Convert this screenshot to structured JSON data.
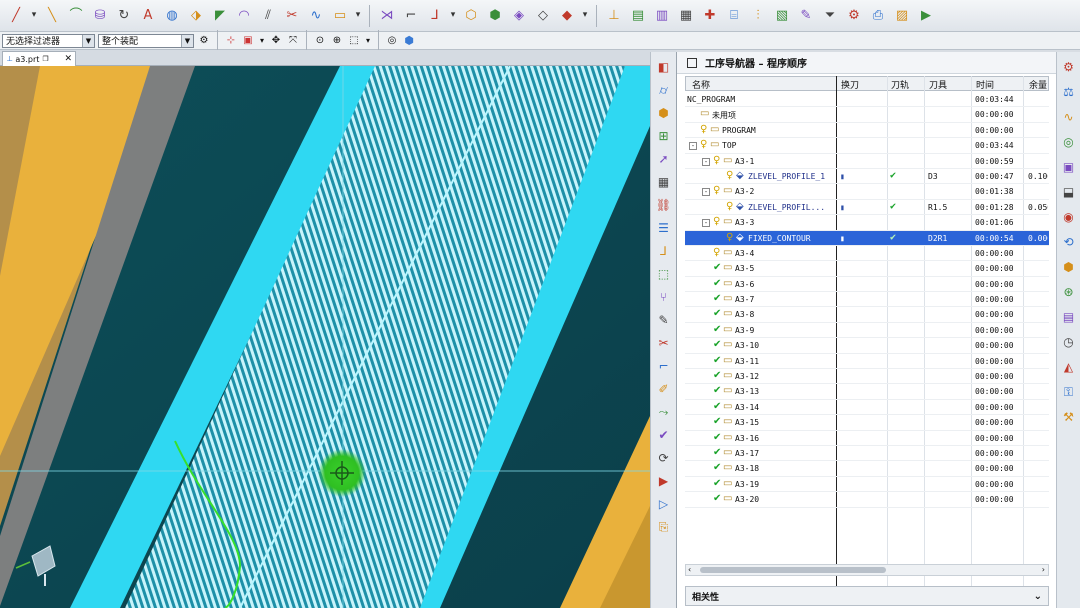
{
  "toolbar": {
    "icons": [
      "line-icon",
      "dropdown-icon",
      "line2-icon",
      "arc-icon",
      "cylinder-icon",
      "rotate-icon",
      "text-icon",
      "hole-icon",
      "extrude-icon",
      "chamfer-icon",
      "blend-icon",
      "offset-icon",
      "trim-icon",
      "curve-icon",
      "rectangle-icon",
      "dropdown-icon",
      "shear-icon",
      "fillet-icon",
      "bend-icon",
      "dropdown-icon",
      "tool-icon",
      "tool2-icon",
      "tool3-icon",
      "tool4-icon",
      "tool5-icon",
      "dropdown-icon",
      "axes-icon",
      "program-icon",
      "geometry-icon",
      "method-icon",
      "create-icon",
      "machine-icon",
      "align-icon",
      "report-icon",
      "edit-icon",
      "filter-icon",
      "gear-icon",
      "postprocess-icon",
      "shop-doc-icon",
      "verify-icon"
    ]
  },
  "toolbar2": {
    "filter_value": "无选择过滤器",
    "assembly_value": "整个装配"
  },
  "file_tab": {
    "label": "a3.prt"
  },
  "navigator": {
    "title": "工序导航器 – 程序顺序",
    "columns": [
      "名称",
      "换刀",
      "刀轨",
      "刀具",
      "时间",
      "余量"
    ],
    "rows": [
      {
        "name": "NC_PROGRAM",
        "indent": 0,
        "icon": "none",
        "fold": "",
        "tool_change": "",
        "path": "",
        "tool": "",
        "time": "00:03:44",
        "stock": ""
      },
      {
        "name": "未用项",
        "indent": 1,
        "icon": "folder",
        "fold": "",
        "tool_change": "",
        "path": "",
        "tool": "",
        "time": "00:00:00",
        "stock": ""
      },
      {
        "name": "PROGRAM",
        "indent": 1,
        "icon": "key",
        "fold": "",
        "tool_change": "",
        "path": "",
        "tool": "",
        "time": "00:00:00",
        "stock": ""
      },
      {
        "name": "TOP",
        "indent": 1,
        "icon": "key",
        "fold": "-",
        "tool_change": "",
        "path": "",
        "tool": "",
        "time": "00:03:44",
        "stock": ""
      },
      {
        "name": "A3-1",
        "indent": 2,
        "icon": "key",
        "fold": "-",
        "tool_change": "",
        "path": "",
        "tool": "",
        "time": "00:00:59",
        "stock": ""
      },
      {
        "name": "ZLEVEL_PROFILE_1",
        "indent": 3,
        "icon": "op",
        "fold": "",
        "tool_change": "▮",
        "path": "✔",
        "tool": "D3",
        "time": "00:00:47",
        "stock": "0.100"
      },
      {
        "name": "A3-2",
        "indent": 2,
        "icon": "key",
        "fold": "-",
        "tool_change": "",
        "path": "",
        "tool": "",
        "time": "00:01:38",
        "stock": ""
      },
      {
        "name": "ZLEVEL_PROFIL...",
        "indent": 3,
        "icon": "op",
        "fold": "",
        "tool_change": "▮",
        "path": "✔",
        "tool": "R1.5",
        "time": "00:01:28",
        "stock": "0.050"
      },
      {
        "name": "A3-3",
        "indent": 2,
        "icon": "key",
        "fold": "-",
        "tool_change": "",
        "path": "",
        "tool": "",
        "time": "00:01:06",
        "stock": ""
      },
      {
        "name": "FIXED_CONTOUR",
        "indent": 3,
        "icon": "op",
        "fold": "",
        "tool_change": "▮",
        "path": "✔",
        "tool": "D2R1",
        "time": "00:00:54",
        "stock": "0.000",
        "selected": true
      },
      {
        "name": "A3-4",
        "indent": 2,
        "icon": "key",
        "fold": "",
        "tool_change": "",
        "path": "",
        "tool": "",
        "time": "00:00:00",
        "stock": ""
      },
      {
        "name": "A3-5",
        "indent": 2,
        "icon": "check",
        "fold": "",
        "tool_change": "",
        "path": "",
        "tool": "",
        "time": "00:00:00",
        "stock": ""
      },
      {
        "name": "A3-6",
        "indent": 2,
        "icon": "check",
        "fold": "",
        "tool_change": "",
        "path": "",
        "tool": "",
        "time": "00:00:00",
        "stock": ""
      },
      {
        "name": "A3-7",
        "indent": 2,
        "icon": "check",
        "fold": "",
        "tool_change": "",
        "path": "",
        "tool": "",
        "time": "00:00:00",
        "stock": ""
      },
      {
        "name": "A3-8",
        "indent": 2,
        "icon": "check",
        "fold": "",
        "tool_change": "",
        "path": "",
        "tool": "",
        "time": "00:00:00",
        "stock": ""
      },
      {
        "name": "A3-9",
        "indent": 2,
        "icon": "check",
        "fold": "",
        "tool_change": "",
        "path": "",
        "tool": "",
        "time": "00:00:00",
        "stock": ""
      },
      {
        "name": "A3-10",
        "indent": 2,
        "icon": "check",
        "fold": "",
        "tool_change": "",
        "path": "",
        "tool": "",
        "time": "00:00:00",
        "stock": ""
      },
      {
        "name": "A3-11",
        "indent": 2,
        "icon": "check",
        "fold": "",
        "tool_change": "",
        "path": "",
        "tool": "",
        "time": "00:00:00",
        "stock": ""
      },
      {
        "name": "A3-12",
        "indent": 2,
        "icon": "check",
        "fold": "",
        "tool_change": "",
        "path": "",
        "tool": "",
        "time": "00:00:00",
        "stock": ""
      },
      {
        "name": "A3-13",
        "indent": 2,
        "icon": "check",
        "fold": "",
        "tool_change": "",
        "path": "",
        "tool": "",
        "time": "00:00:00",
        "stock": ""
      },
      {
        "name": "A3-14",
        "indent": 2,
        "icon": "check",
        "fold": "",
        "tool_change": "",
        "path": "",
        "tool": "",
        "time": "00:00:00",
        "stock": ""
      },
      {
        "name": "A3-15",
        "indent": 2,
        "icon": "check",
        "fold": "",
        "tool_change": "",
        "path": "",
        "tool": "",
        "time": "00:00:00",
        "stock": ""
      },
      {
        "name": "A3-16",
        "indent": 2,
        "icon": "check",
        "fold": "",
        "tool_change": "",
        "path": "",
        "tool": "",
        "time": "00:00:00",
        "stock": ""
      },
      {
        "name": "A3-17",
        "indent": 2,
        "icon": "check",
        "fold": "",
        "tool_change": "",
        "path": "",
        "tool": "",
        "time": "00:00:00",
        "stock": ""
      },
      {
        "name": "A3-18",
        "indent": 2,
        "icon": "check",
        "fold": "",
        "tool_change": "",
        "path": "",
        "tool": "",
        "time": "00:00:00",
        "stock": ""
      },
      {
        "name": "A3-19",
        "indent": 2,
        "icon": "check",
        "fold": "",
        "tool_change": "",
        "path": "",
        "tool": "",
        "time": "00:00:00",
        "stock": ""
      },
      {
        "name": "A3-20",
        "indent": 2,
        "icon": "check",
        "fold": "",
        "tool_change": "",
        "path": "",
        "tool": "",
        "time": "00:00:00",
        "stock": ""
      }
    ],
    "related_label": "相关性"
  },
  "colors": {
    "toolpath": "#2fd8f2",
    "part_dark": "#0f4a55",
    "stock_gold": "#e9b13c",
    "selection": "#2b64d8",
    "check_green": "#1aa32a"
  },
  "vertical_strip": {
    "icons": [
      "plane-icon",
      "tube-icon",
      "cube-icon",
      "measure-icon",
      "arrow-icon",
      "grid-icon",
      "assembly-icon",
      "layer-icon",
      "bend-icon",
      "select-icon",
      "tree-icon",
      "edit-icon",
      "trim-icon",
      "fillet-icon",
      "sketch-icon",
      "path-icon",
      "check-icon",
      "gen-icon",
      "verify-icon",
      "sim-icon",
      "post-icon"
    ]
  },
  "right_strip": {
    "icons": [
      "gear-icon",
      "analysis-icon",
      "curve-icon",
      "view-icon",
      "layout-icon",
      "part-icon",
      "roles-icon",
      "history-icon",
      "cube-icon",
      "system-icon",
      "document-icon",
      "clock-icon",
      "palette-icon",
      "key-icon",
      "brush-icon"
    ]
  }
}
